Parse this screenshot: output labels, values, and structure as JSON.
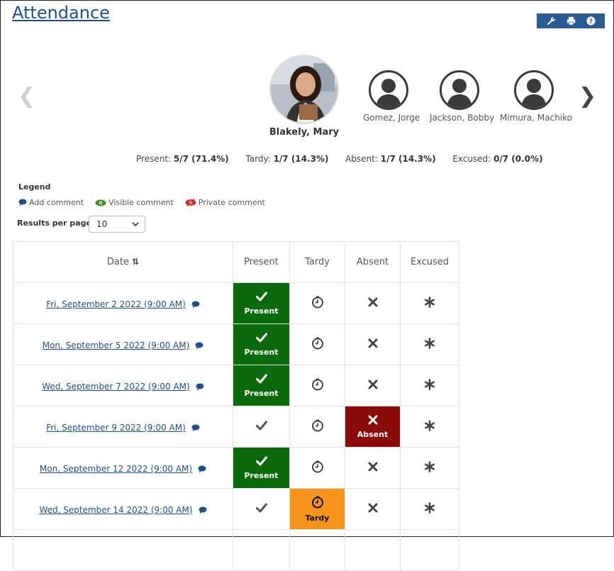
{
  "page": {
    "title": "Attendance"
  },
  "toolbar": {
    "icons": [
      "wrench-icon",
      "print-icon",
      "help-icon"
    ]
  },
  "students": {
    "selected": {
      "name": "Blakely, Mary"
    },
    "others": [
      {
        "name": "Gomez, Jorge"
      },
      {
        "name": "Jackson, Bobby"
      },
      {
        "name": "Mimura, Machiko"
      }
    ]
  },
  "stats": {
    "present_label": "Present:",
    "present_value": "5/7 (71.4%)",
    "tardy_label": "Tardy:",
    "tardy_value": "1/7 (14.3%)",
    "absent_label": "Absent:",
    "absent_value": "1/7 (14.3%)",
    "excused_label": "Excused:",
    "excused_value": "0/7 (0.0%)"
  },
  "legend": {
    "title": "Legend",
    "add_comment": "Add comment",
    "visible_comment": "Visible comment",
    "private_comment": "Private comment"
  },
  "results_per_page": {
    "label": "Results per page:",
    "value": "10"
  },
  "table": {
    "headers": {
      "date": "Date",
      "present": "Present",
      "tardy": "Tardy",
      "absent": "Absent",
      "excused": "Excused"
    },
    "status_labels": {
      "present": "Present",
      "tardy": "Tardy",
      "absent": "Absent"
    },
    "rows": [
      {
        "date": "Fri, September 2 2022 (9:00 AM)",
        "status": "present"
      },
      {
        "date": "Mon, September 5 2022 (9:00 AM)",
        "status": "present"
      },
      {
        "date": "Wed, September 7 2022 (9:00 AM)",
        "status": "present"
      },
      {
        "date": "Fri, September 9 2022 (9:00 AM)",
        "status": "absent"
      },
      {
        "date": "Mon, September 12 2022 (9:00 AM)",
        "status": "present"
      },
      {
        "date": "Wed, September 14 2022 (9:00 AM)",
        "status": "tardy"
      }
    ]
  },
  "colors": {
    "present": "#0b6a0b",
    "absent": "#8b0b0b",
    "tardy": "#f7941d",
    "link": "#1e4f86",
    "toolbar": "#2b5b95"
  }
}
